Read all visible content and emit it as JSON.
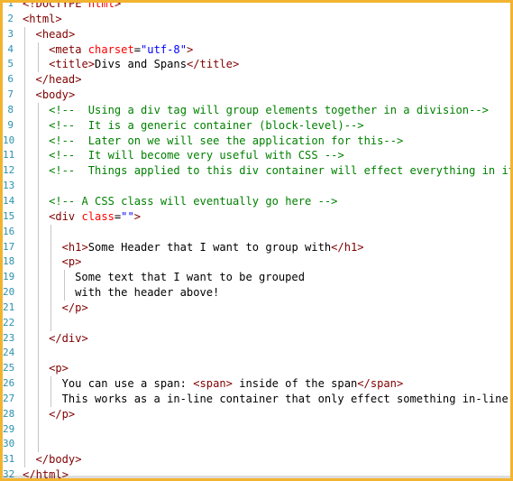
{
  "editor": {
    "lines": [
      {
        "n": "1",
        "i": 0,
        "t": [
          [
            "br",
            "<!"
          ],
          [
            "tg",
            "DOCTYPE"
          ],
          [
            "tx",
            " "
          ],
          [
            "at",
            "html"
          ],
          [
            "br",
            ">"
          ]
        ]
      },
      {
        "n": "2",
        "i": 0,
        "t": [
          [
            "br",
            "<"
          ],
          [
            "tg",
            "html"
          ],
          [
            "br",
            ">"
          ]
        ]
      },
      {
        "n": "3",
        "i": 1,
        "t": [
          [
            "br",
            "<"
          ],
          [
            "tg",
            "head"
          ],
          [
            "br",
            ">"
          ]
        ]
      },
      {
        "n": "4",
        "i": 2,
        "t": [
          [
            "br",
            "<"
          ],
          [
            "tg",
            "meta"
          ],
          [
            "tx",
            " "
          ],
          [
            "at",
            "charset"
          ],
          [
            "tx",
            "="
          ],
          [
            "av",
            "\"utf-8\""
          ],
          [
            "br",
            ">"
          ]
        ]
      },
      {
        "n": "5",
        "i": 2,
        "t": [
          [
            "br",
            "<"
          ],
          [
            "tg",
            "title"
          ],
          [
            "br",
            ">"
          ],
          [
            "tx",
            "Divs and Spans"
          ],
          [
            "br",
            "</"
          ],
          [
            "tg",
            "title"
          ],
          [
            "br",
            ">"
          ]
        ]
      },
      {
        "n": "6",
        "i": 1,
        "t": [
          [
            "br",
            "</"
          ],
          [
            "tg",
            "head"
          ],
          [
            "br",
            ">"
          ]
        ]
      },
      {
        "n": "7",
        "i": 1,
        "t": [
          [
            "br",
            "<"
          ],
          [
            "tg",
            "body"
          ],
          [
            "br",
            ">"
          ]
        ]
      },
      {
        "n": "8",
        "i": 2,
        "t": [
          [
            "cm",
            "<!--  Using a div tag will group elements together in a division-->"
          ]
        ]
      },
      {
        "n": "9",
        "i": 2,
        "t": [
          [
            "cm",
            "<!--  It is a generic container (block-level)-->"
          ]
        ]
      },
      {
        "n": "10",
        "i": 2,
        "t": [
          [
            "cm",
            "<!--  Later on we will see the application for this-->"
          ]
        ]
      },
      {
        "n": "11",
        "i": 2,
        "t": [
          [
            "cm",
            "<!--  It will become very useful with CSS -->"
          ]
        ]
      },
      {
        "n": "12",
        "i": 2,
        "t": [
          [
            "cm",
            "<!--  Things applied to this div container will effect everything in it-->"
          ]
        ]
      },
      {
        "n": "13",
        "i": 2,
        "t": []
      },
      {
        "n": "14",
        "i": 2,
        "t": [
          [
            "cm",
            "<!-- A CSS class will eventually go here -->"
          ]
        ]
      },
      {
        "n": "15",
        "i": 2,
        "t": [
          [
            "br",
            "<"
          ],
          [
            "tg",
            "div"
          ],
          [
            "tx",
            " "
          ],
          [
            "at",
            "class"
          ],
          [
            "tx",
            "="
          ],
          [
            "av",
            "\"\""
          ],
          [
            "br",
            ">"
          ]
        ]
      },
      {
        "n": "16",
        "i": 3,
        "t": []
      },
      {
        "n": "17",
        "i": 3,
        "t": [
          [
            "br",
            "<"
          ],
          [
            "tg",
            "h1"
          ],
          [
            "br",
            ">"
          ],
          [
            "tx",
            "Some Header that I want to group with"
          ],
          [
            "br",
            "</"
          ],
          [
            "tg",
            "h1"
          ],
          [
            "br",
            ">"
          ]
        ]
      },
      {
        "n": "18",
        "i": 3,
        "t": [
          [
            "br",
            "<"
          ],
          [
            "tg",
            "p"
          ],
          [
            "br",
            ">"
          ]
        ]
      },
      {
        "n": "19",
        "i": 4,
        "t": [
          [
            "tx",
            "Some text that I want to be grouped"
          ]
        ]
      },
      {
        "n": "20",
        "i": 4,
        "t": [
          [
            "tx",
            "with the header above!"
          ]
        ]
      },
      {
        "n": "21",
        "i": 3,
        "t": [
          [
            "br",
            "</"
          ],
          [
            "tg",
            "p"
          ],
          [
            "br",
            ">"
          ]
        ]
      },
      {
        "n": "22",
        "i": 3,
        "t": []
      },
      {
        "n": "23",
        "i": 2,
        "t": [
          [
            "br",
            "</"
          ],
          [
            "tg",
            "div"
          ],
          [
            "br",
            ">"
          ]
        ]
      },
      {
        "n": "24",
        "i": 2,
        "t": []
      },
      {
        "n": "25",
        "i": 2,
        "t": [
          [
            "br",
            "<"
          ],
          [
            "tg",
            "p"
          ],
          [
            "br",
            ">"
          ]
        ]
      },
      {
        "n": "26",
        "i": 3,
        "t": [
          [
            "tx",
            "You can use a span: "
          ],
          [
            "br",
            "<"
          ],
          [
            "tg",
            "span"
          ],
          [
            "br",
            ">"
          ],
          [
            "tx",
            " inside of the span"
          ],
          [
            "br",
            "</"
          ],
          [
            "tg",
            "span"
          ],
          [
            "br",
            ">"
          ]
        ]
      },
      {
        "n": "27",
        "i": 3,
        "t": [
          [
            "tx",
            "This works as a in-line container that only effect something in-line!"
          ]
        ]
      },
      {
        "n": "28",
        "i": 2,
        "t": [
          [
            "br",
            "</"
          ],
          [
            "tg",
            "p"
          ],
          [
            "br",
            ">"
          ]
        ]
      },
      {
        "n": "29",
        "i": 2,
        "t": []
      },
      {
        "n": "30",
        "i": 2,
        "t": []
      },
      {
        "n": "31",
        "i": 1,
        "t": [
          [
            "br",
            "</"
          ],
          [
            "tg",
            "body"
          ],
          [
            "br",
            ">"
          ]
        ]
      },
      {
        "n": "32",
        "i": 0,
        "t": [
          [
            "br",
            "</"
          ],
          [
            "tg",
            "html"
          ],
          [
            "br",
            ">"
          ]
        ]
      }
    ]
  }
}
